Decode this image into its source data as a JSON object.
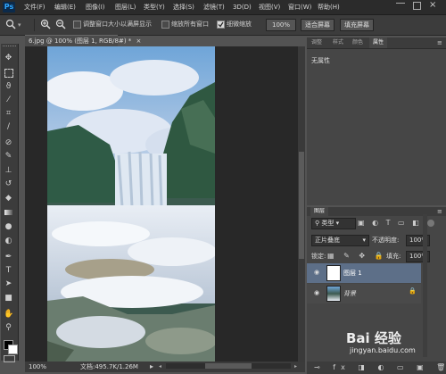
{
  "app": {
    "logo": "Ps"
  },
  "menu": [
    "文件(F)",
    "编辑(E)",
    "图像(I)",
    "图层(L)",
    "类型(Y)",
    "选择(S)",
    "滤镜(T)",
    "3D(D)",
    "视图(V)",
    "窗口(W)",
    "帮助(H)"
  ],
  "options": {
    "resize_windows": "调整窗口大小以满屏显示",
    "zoom_all": "缩放所有窗口",
    "scrubby_zoom": "细微缩放",
    "percent": "100%",
    "fit_screen": "适合屏幕",
    "fill_screen": "填充屏幕"
  },
  "document": {
    "tab_title": "6.jpg @ 100% (图层 1, RGB/8#) *",
    "tab_close": "×",
    "status_zoom": "100%",
    "status_doc": "文档:495.7K/1.26M"
  },
  "properties_panel": {
    "tabs": [
      "调整",
      "样式",
      "颜色",
      "属性"
    ],
    "active_tab": "属性",
    "content": "无属性"
  },
  "layers_panel": {
    "tab": "图层",
    "filter_kind": "类型",
    "blend_mode": "正片叠底",
    "opacity_label": "不透明度:",
    "opacity_value": "100%",
    "lock_label": "锁定:",
    "fill_label": "填充:",
    "fill_value": "100%",
    "layers": [
      {
        "name": "图层 1",
        "selected": true
      },
      {
        "name": "背景",
        "selected": false,
        "locked": true
      }
    ]
  },
  "watermark": {
    "text": "Bai 经验",
    "url": "jingyan.baidu.com"
  },
  "icons": [
    "zoom-icon",
    "zoom-in-icon",
    "zoom-out-icon",
    "move-tool-icon",
    "marquee-tool-icon",
    "lasso-tool-icon",
    "magic-wand-icon",
    "crop-tool-icon",
    "eyedropper-icon",
    "healing-brush-icon",
    "brush-tool-icon",
    "clone-stamp-icon",
    "history-brush-icon",
    "eraser-icon",
    "gradient-icon",
    "blur-icon",
    "dodge-icon",
    "pen-tool-icon",
    "type-tool-icon",
    "path-select-icon",
    "shape-tool-icon",
    "hand-tool-icon",
    "zoom-tool-icon",
    "eye-icon",
    "lock-icon"
  ],
  "colors": {
    "ui_dark": "#2b2b2b",
    "panel": "#464646",
    "selected_layer": "#5d6f88",
    "accent_blue": "#30a8ff"
  }
}
